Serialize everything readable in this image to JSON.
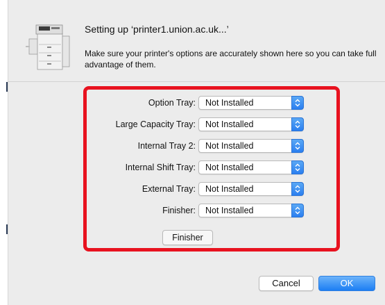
{
  "dialog": {
    "title": "Setting up ‘printer1.union.ac.uk...’",
    "message": "Make sure your printer's options are accurately shown here so you can take full advantage of them."
  },
  "options": [
    {
      "label": "Option Tray:",
      "value": "Not Installed"
    },
    {
      "label": "Large Capacity Tray:",
      "value": "Not Installed"
    },
    {
      "label": "Internal Tray 2:",
      "value": "Not Installed"
    },
    {
      "label": "Internal Shift Tray:",
      "value": "Not Installed"
    },
    {
      "label": "External Tray:",
      "value": "Not Installed"
    },
    {
      "label": "Finisher:",
      "value": "Not Installed"
    }
  ],
  "finisher_button": "Finisher",
  "buttons": {
    "cancel": "Cancel",
    "ok": "OK"
  },
  "colors": {
    "highlight": "#e8121f",
    "accent": "#1c7ef3"
  },
  "icons": {
    "printer": "printer-icon",
    "popup_arrows": "updown-arrows-icon"
  }
}
